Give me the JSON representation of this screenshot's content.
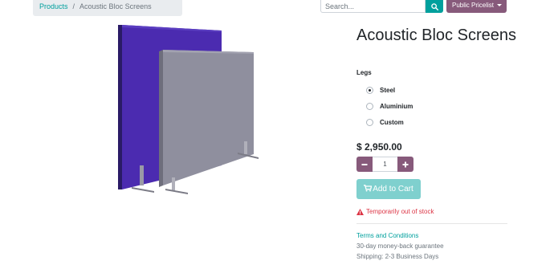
{
  "breadcrumb": {
    "parent": "Products",
    "separator": "/",
    "current": "Acoustic Bloc Screens"
  },
  "search": {
    "placeholder": "Search..."
  },
  "pricelist": {
    "label": "Public Pricelist"
  },
  "product": {
    "title": "Acoustic Bloc Screens",
    "attribute_label": "Legs",
    "options": [
      {
        "label": "Steel",
        "checked": true
      },
      {
        "label": "Aluminium",
        "checked": false
      },
      {
        "label": "Custom",
        "checked": false
      }
    ],
    "price": "$ 2,950.00",
    "quantity": "1",
    "add_to_cart": "Add to Cart",
    "stock_status": "Temporarily out of stock",
    "terms_link": "Terms and Conditions",
    "guarantee": "30-day money-back guarantee",
    "shipping": "Shipping: 2-3 Business Days"
  },
  "colors": {
    "primary": "#00a09d",
    "secondary": "#875a7b",
    "danger": "#dc3545",
    "screen_front": "#8f8f9e",
    "screen_back": "#4b2bb0"
  },
  "icons": {
    "search": "search-icon",
    "caret": "caret-down-icon",
    "minus": "minus-icon",
    "plus": "plus-icon",
    "cart": "shopping-cart-icon",
    "warning": "warning-icon"
  }
}
